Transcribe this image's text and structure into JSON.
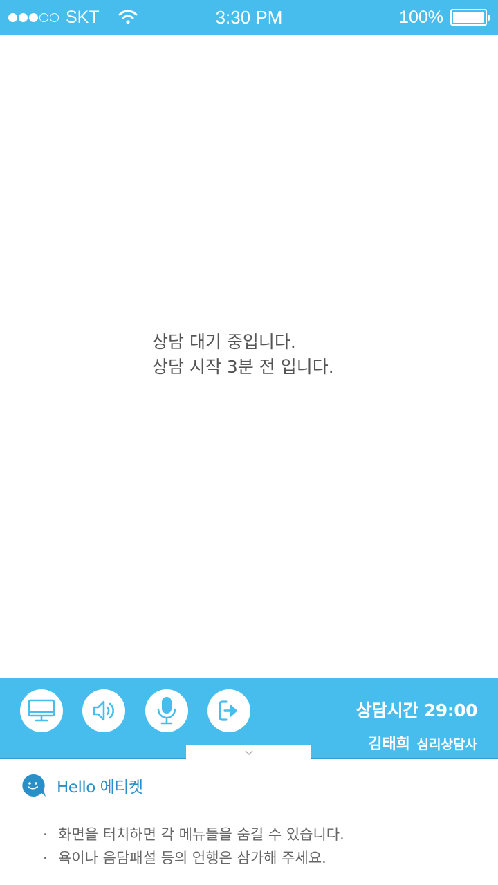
{
  "status_bar": {
    "carrier": "SKT",
    "signal_bars_filled": 3,
    "signal_bars_total": 5,
    "time": "3:30 PM",
    "battery": "100%",
    "background_color": "#47bdee"
  },
  "waiting": {
    "line1": "상담 대기 중입니다.",
    "line2": "상담 시작 3분 전 입니다."
  },
  "controls": {
    "buttons": [
      {
        "icon": "monitor-icon"
      },
      {
        "icon": "speaker-icon"
      },
      {
        "icon": "microphone-icon"
      },
      {
        "icon": "exit-icon"
      }
    ],
    "session_time": "상담시간 29:00",
    "counselor_name": "김태희",
    "counselor_role": "심리상담사",
    "toggle_icon": "chevron-down-icon",
    "accent_color": "#47bdee"
  },
  "etiquette": {
    "icon": "smile-chat-icon",
    "title": "Hello 에티켓",
    "items": [
      "화면을 터치하면 각 메뉴들을 숨길 수 있습니다.",
      "욕이나 음담패설 등의 언행은 삼가해 주세요."
    ]
  }
}
